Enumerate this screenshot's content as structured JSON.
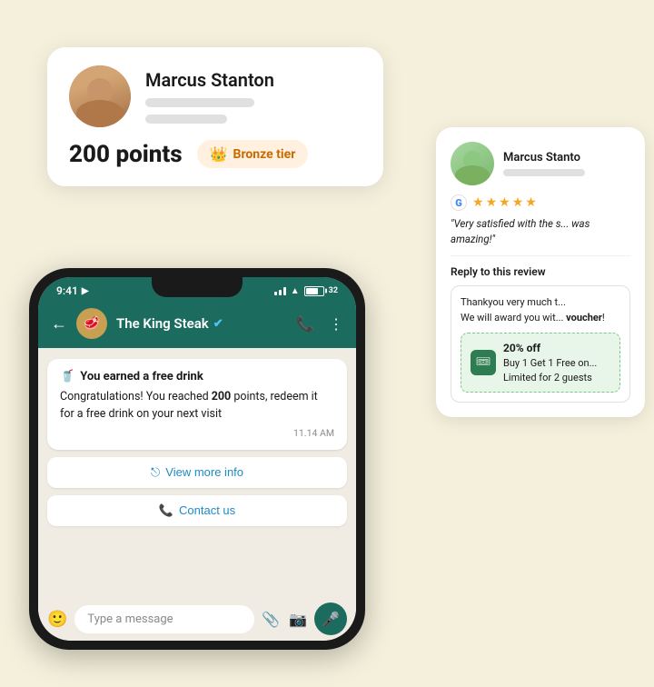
{
  "background": "#f5f0dc",
  "profileCard": {
    "name": "Marcus Stanton",
    "points_label": "200 points",
    "tier_label": "Bronze tier",
    "crown": "👑"
  },
  "phone": {
    "time": "9:41",
    "contact_name": "The King Steak",
    "verified_symbol": "✔",
    "message_header_icon": "🥤",
    "message_header": "You earned a free drink",
    "message_body_1": "Congratulations! You reached ",
    "message_body_bold": "200",
    "message_body_2": " points, redeem it for a free drink on your next visit",
    "message_time": "11.14 AM",
    "view_more_icon": "⎋",
    "view_more_label": "View more info",
    "contact_icon": "📞",
    "contact_label": "Contact us",
    "input_placeholder": "Type a message"
  },
  "reviewCard": {
    "name": "Marcus Stanto",
    "stars": [
      "★",
      "★",
      "★",
      "★",
      "★"
    ],
    "quote": "\"Very satisfied with the s... was amazing!\"",
    "reply_label": "Reply to this review",
    "reply_text_1": "Thankyou very much t...",
    "reply_text_2": "We will award you wit...",
    "reply_bold": "voucher",
    "voucher_title": "20% off",
    "voucher_body": "Buy 1 Get 1 Free on... Limited for 2 guests"
  }
}
